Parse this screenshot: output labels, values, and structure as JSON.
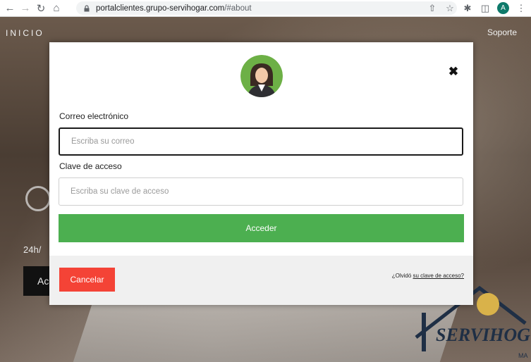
{
  "browser": {
    "url_host": "portalclientes.grupo-servihogar.com",
    "url_path": "/#about",
    "profile_initial": "A"
  },
  "background_page": {
    "nav_left": "INICIO",
    "nav_right": "Soporte",
    "hours_text": "24h/",
    "button_text": "Ac",
    "logo_text": "SERVIHOG",
    "logo_sub": "MA"
  },
  "modal": {
    "email_label": "Correo electrónico",
    "email_placeholder": "Escriba su correo",
    "password_label": "Clave de acceso",
    "password_placeholder": "Escriba su clave de acceso",
    "submit_label": "Acceder",
    "cancel_label": "Cancelar",
    "forgot_prefix": "¿Olvidó",
    "forgot_link": "su clave de acceso?"
  },
  "colors": {
    "accent_green": "#4caf50",
    "cancel_red": "#f44336"
  }
}
